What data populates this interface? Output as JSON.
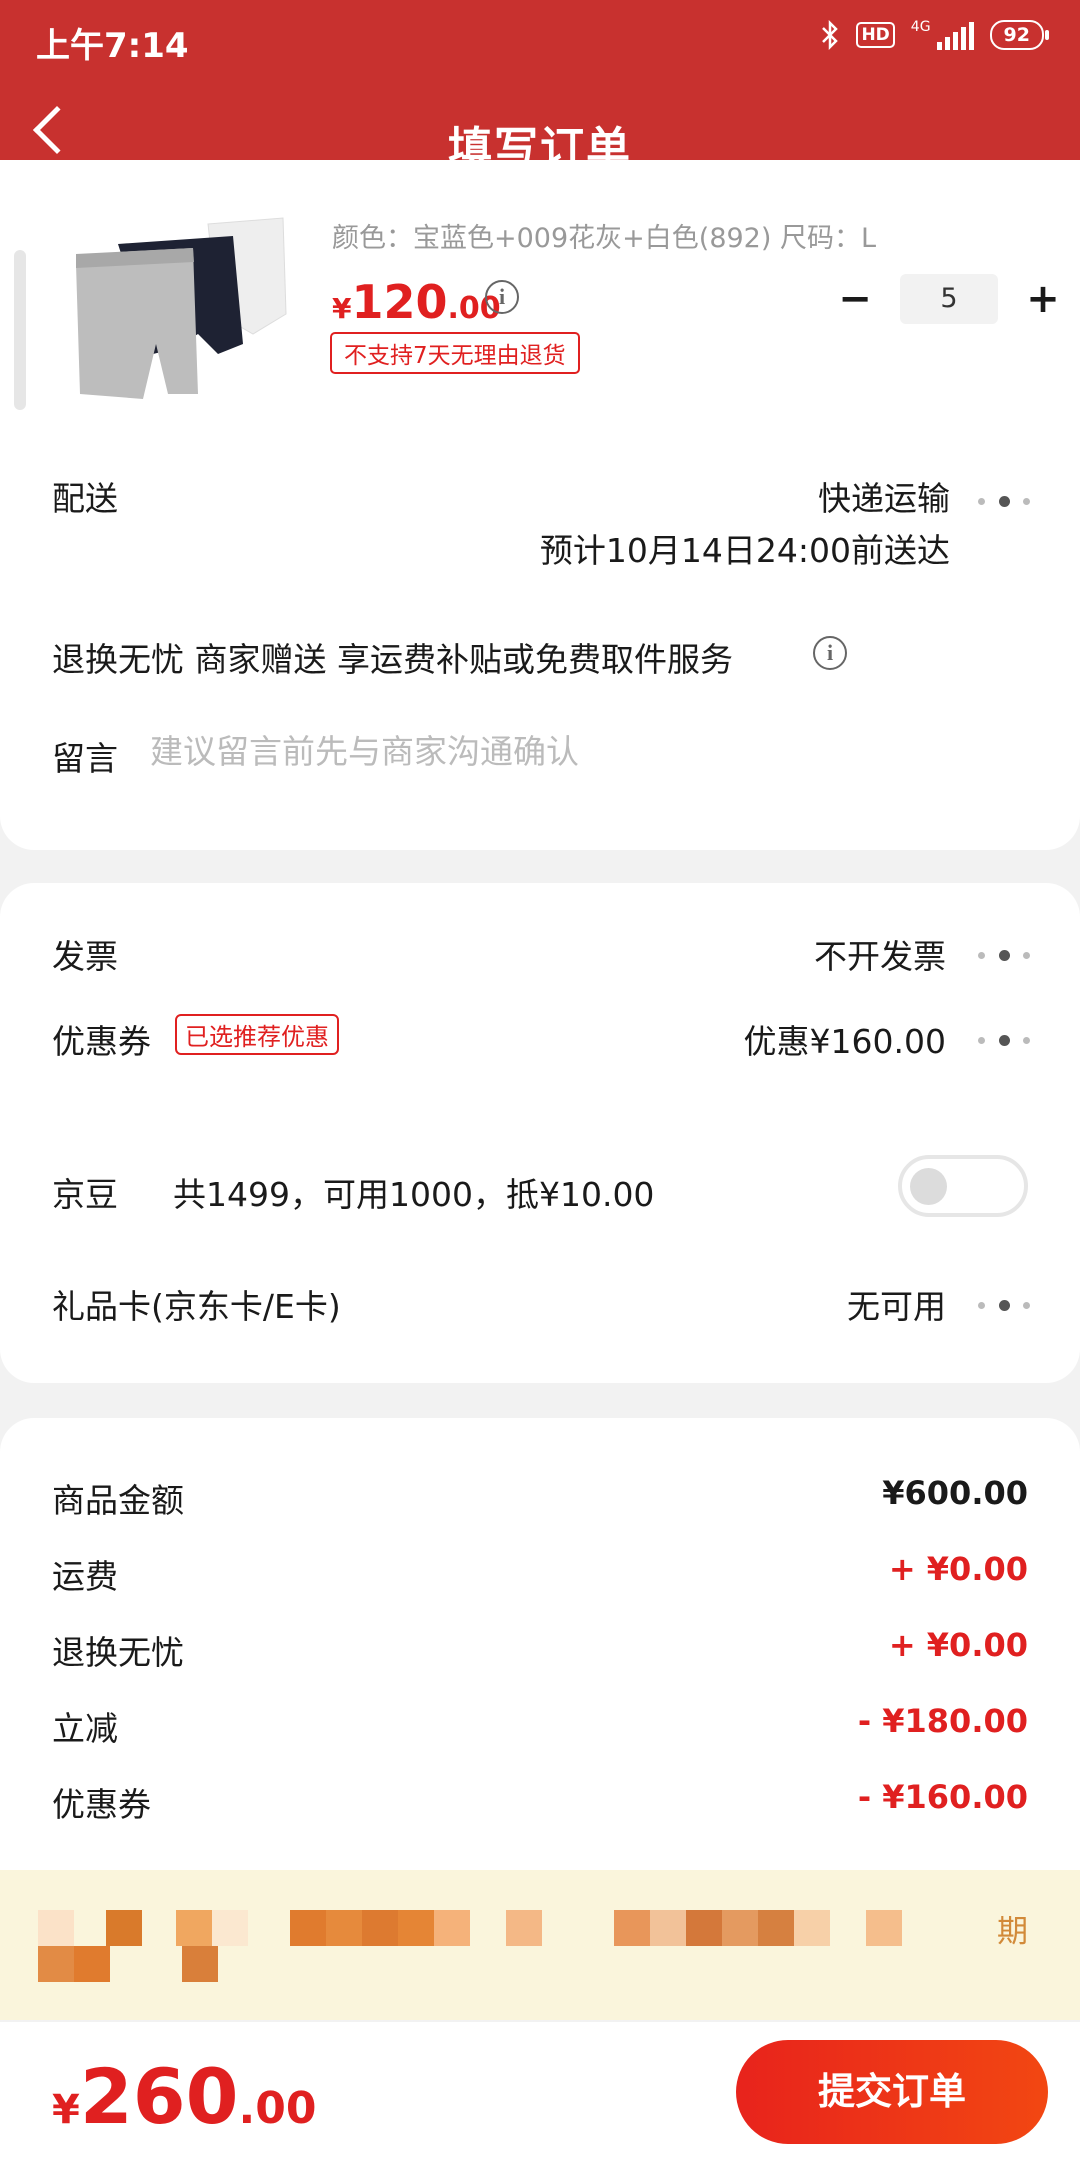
{
  "status_bar": {
    "time": "上午7:14",
    "hd": "HD",
    "network": "4G",
    "battery": "92"
  },
  "header": {
    "title": "填写订单"
  },
  "product": {
    "spec": "颜色：宝蓝色+009花灰+白色(892)   尺码：L",
    "price_currency": "¥",
    "price_int": "120",
    "price_dec": ".00",
    "return_tag": "不支持7天无理由退货",
    "quantity": "5",
    "minus": "−",
    "plus": "+"
  },
  "delivery": {
    "label": "配送",
    "method": "快递运输",
    "eta": "预计10月14日24:00前送达"
  },
  "service": {
    "text": "退换无忧 商家赠送 享运费补贴或免费取件服务"
  },
  "message": {
    "label": "留言",
    "placeholder": "建议留言前先与商家沟通确认"
  },
  "invoice": {
    "label": "发票",
    "value": "不开发票"
  },
  "coupon": {
    "label": "优惠券",
    "tag": "已选推荐优惠",
    "value": "优惠¥160.00"
  },
  "jingdou": {
    "label": "京豆",
    "text": "共1499，可用1000，抵¥10.00",
    "enabled": false
  },
  "giftcard": {
    "label": "礼品卡(京东卡/E卡)",
    "value": "无可用"
  },
  "summary": [
    {
      "label": "商品金额",
      "value": "¥600.00",
      "color": "#1a1a1a"
    },
    {
      "label": "运费",
      "value": "+ ¥0.00",
      "color": "#e02020"
    },
    {
      "label": "退换无忧",
      "value": "+ ¥0.00",
      "color": "#e02020"
    },
    {
      "label": "立减",
      "value": "- ¥180.00",
      "color": "#e02020"
    },
    {
      "label": "优惠券",
      "value": "- ¥160.00",
      "color": "#e02020"
    }
  ],
  "promo": {
    "suffix": "期"
  },
  "footer": {
    "currency": "¥",
    "total_int": "260",
    "total_dec": ".00",
    "submit": "提交订单"
  },
  "colors": {
    "brand_red": "#c8312f",
    "price_red": "#e02020",
    "promo_bg": "#faf5dc"
  }
}
